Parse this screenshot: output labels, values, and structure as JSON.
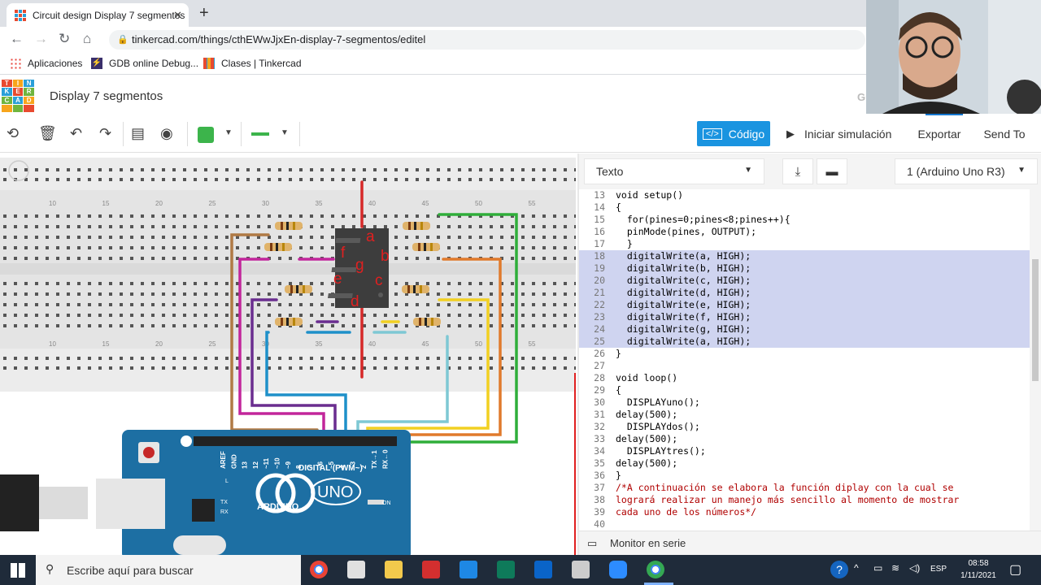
{
  "browser": {
    "tab_title": "Circuit design Display 7 segmentos",
    "url": "tinkercad.com/things/cthEWwJjxEn-display-7-segmentos/editel",
    "bookmarks": [
      "Aplicaciones",
      "GDB online Debug...",
      "Clases | Tinkercad"
    ]
  },
  "app": {
    "logo_letters": [
      "T",
      "I",
      "N",
      "K",
      "E",
      "R",
      "C",
      "A",
      "D",
      "",
      "",
      ""
    ],
    "title": "Display 7 segmentos",
    "saved_status": "Guardado"
  },
  "toolbar": {
    "code_label": "Código",
    "simulate_label": "Iniciar simulación",
    "export_label": "Exportar",
    "sendto_label": "Send To",
    "color_value": "#3cb44b"
  },
  "code_panel": {
    "mode_label": "Texto",
    "board_label": "1 (Arduino Uno R3)",
    "serial_monitor_label": "Monitor en serie",
    "lines": [
      {
        "n": "13",
        "text": "void setup()",
        "hl": false
      },
      {
        "n": "14",
        "text": "{",
        "hl": false
      },
      {
        "n": "15",
        "text": "  for(pines=0;pines<8;pines++){",
        "hl": false
      },
      {
        "n": "16",
        "text": "  pinMode(pines, OUTPUT);",
        "hl": false
      },
      {
        "n": "17",
        "text": "  }",
        "hl": false
      },
      {
        "n": "18",
        "text": "  digitalWrite(a, HIGH);",
        "hl": true
      },
      {
        "n": "19",
        "text": "  digitalWrite(b, HIGH);",
        "hl": true
      },
      {
        "n": "20",
        "text": "  digitalWrite(c, HIGH);",
        "hl": true
      },
      {
        "n": "21",
        "text": "  digitalWrite(d, HIGH);",
        "hl": true
      },
      {
        "n": "22",
        "text": "  digitalWrite(e, HIGH);",
        "hl": true
      },
      {
        "n": "23",
        "text": "  digitalWrite(f, HIGH);",
        "hl": true
      },
      {
        "n": "24",
        "text": "  digitalWrite(g, HIGH);",
        "hl": true
      },
      {
        "n": "25",
        "text": "  digitalWrite(a, HIGH);",
        "hl": true
      },
      {
        "n": "26",
        "text": "}",
        "hl": false
      },
      {
        "n": "27",
        "text": "",
        "hl": false
      },
      {
        "n": "28",
        "text": "void loop()",
        "hl": false
      },
      {
        "n": "29",
        "text": "{",
        "hl": false
      },
      {
        "n": "30",
        "text": "  DISPLAYuno();",
        "hl": false
      },
      {
        "n": "31",
        "text": "delay(500);",
        "hl": false
      },
      {
        "n": "32",
        "text": "  DISPLAYdos();",
        "hl": false
      },
      {
        "n": "33",
        "text": "delay(500);",
        "hl": false
      },
      {
        "n": "34",
        "text": "  DISPLAYtres();",
        "hl": false
      },
      {
        "n": "35",
        "text": "delay(500);",
        "hl": false
      },
      {
        "n": "36",
        "text": "}",
        "hl": false
      },
      {
        "n": "37",
        "text": "/*A continuación se elabora la función diplay con la cual se",
        "hl": false,
        "cmt": true
      },
      {
        "n": "38",
        "text": "logrará realizar un manejo más sencillo al momento de mostrar",
        "hl": false,
        "cmt": true
      },
      {
        "n": "39",
        "text": "cada uno de los números*/",
        "hl": false,
        "cmt": true
      },
      {
        "n": "40",
        "text": "",
        "hl": false
      }
    ]
  },
  "circuit": {
    "breadboard_numbers": [
      "10",
      "15",
      "20",
      "25",
      "30",
      "35",
      "40",
      "45",
      "50",
      "55"
    ],
    "segment_letters": [
      "a",
      "b",
      "c",
      "d",
      "e",
      "f",
      "g"
    ],
    "arduino_brand": "ARDUINO",
    "arduino_model": "UNO",
    "digital_label": "DIGITAL (PWM~)",
    "pin_labels": [
      "AREF",
      "GND",
      "13",
      "12",
      "~11",
      "~10",
      "~9",
      "8",
      "7",
      "~6",
      "~5",
      "4",
      "~3",
      "2",
      "TX→1",
      "RX←0"
    ],
    "led_labels": [
      "L",
      "TX",
      "RX",
      "ON"
    ]
  },
  "taskbar": {
    "search_placeholder": "Escribe aquí para buscar",
    "lang": "ESP",
    "time": "08:58",
    "date": "1/11/2021"
  }
}
